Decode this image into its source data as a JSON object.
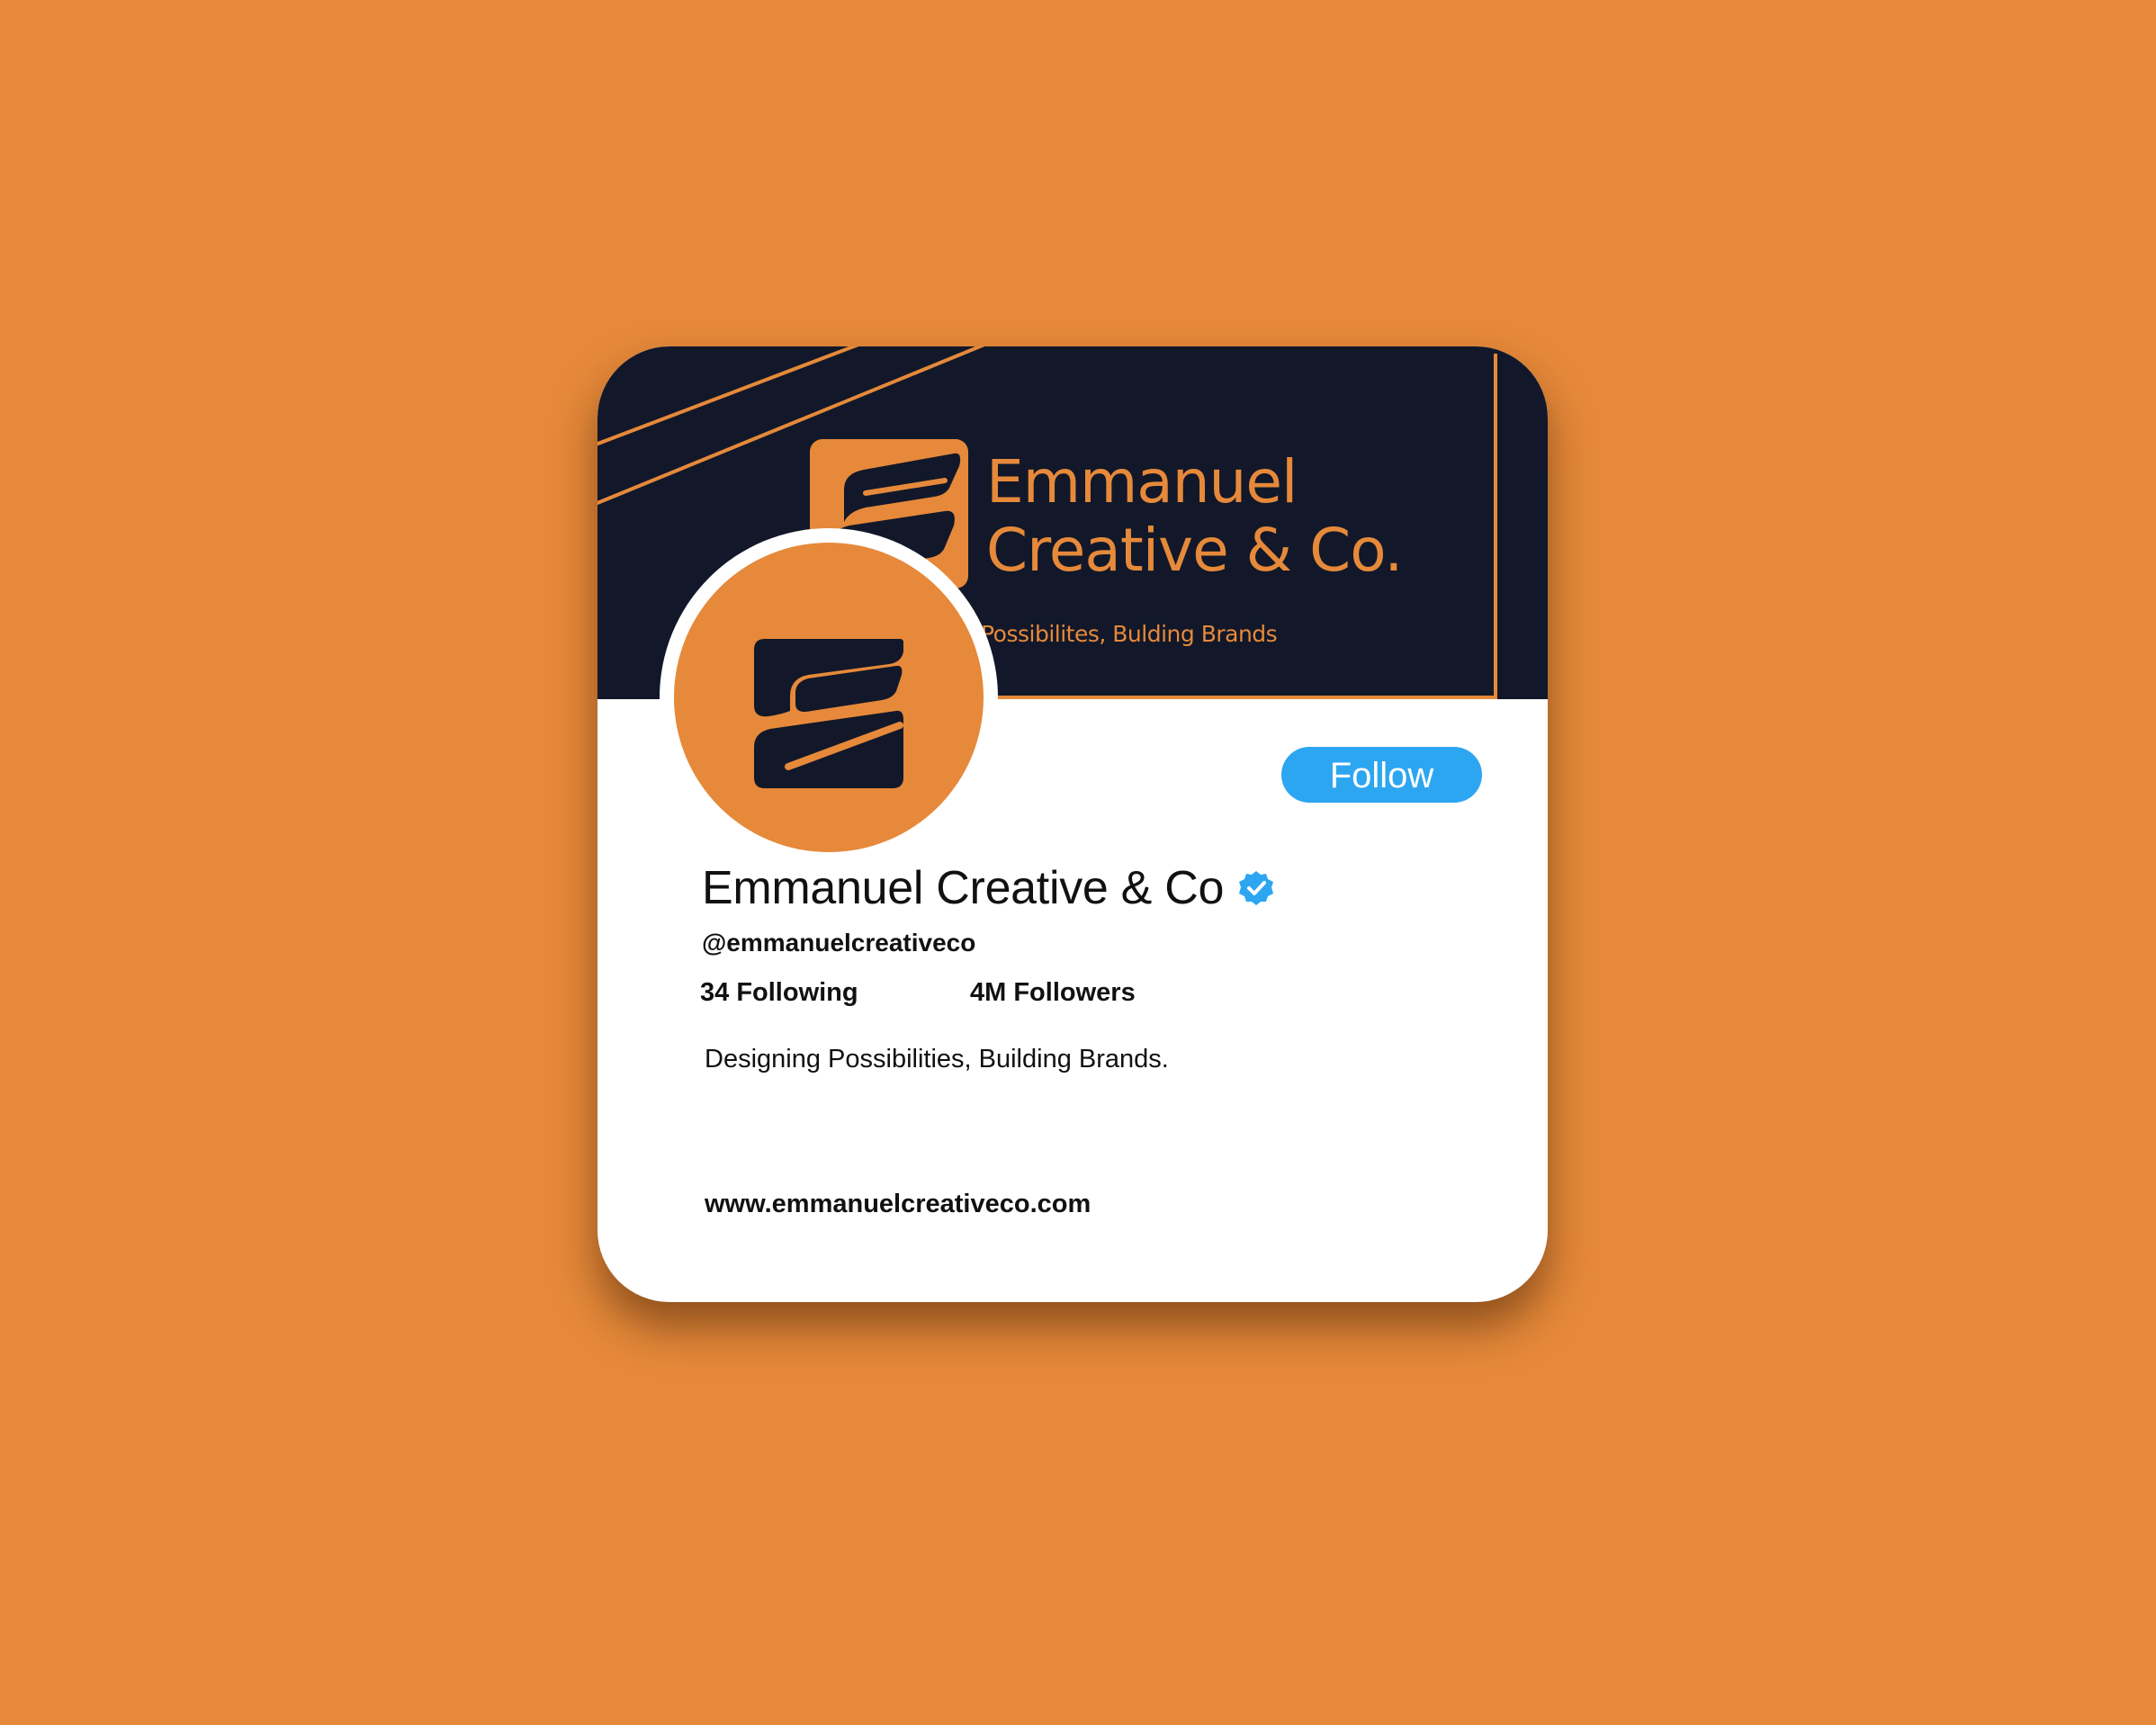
{
  "colors": {
    "background": "#E6893A",
    "banner": "#121829",
    "accent": "#E6893A",
    "follow_button": "#2DA6F1",
    "verified_badge": "#2DA6F1",
    "text": "#111111"
  },
  "banner": {
    "brand_line1": "Emmanuel",
    "brand_line2": "Creative & Co.",
    "tagline": "Possibilites, Bulding Brands"
  },
  "profile": {
    "avatar_icon": "brand-logo-icon",
    "follow_label": "Follow",
    "display_name": "Emmanuel Creative & Co",
    "verified_icon": "verified-badge-icon",
    "handle": "@emmanuelcreativeco",
    "following": "34 Following",
    "followers": "4M Followers",
    "bio": "Designing Possibilities, Building Brands.",
    "website": "www.emmanuelcreativeco.com"
  }
}
